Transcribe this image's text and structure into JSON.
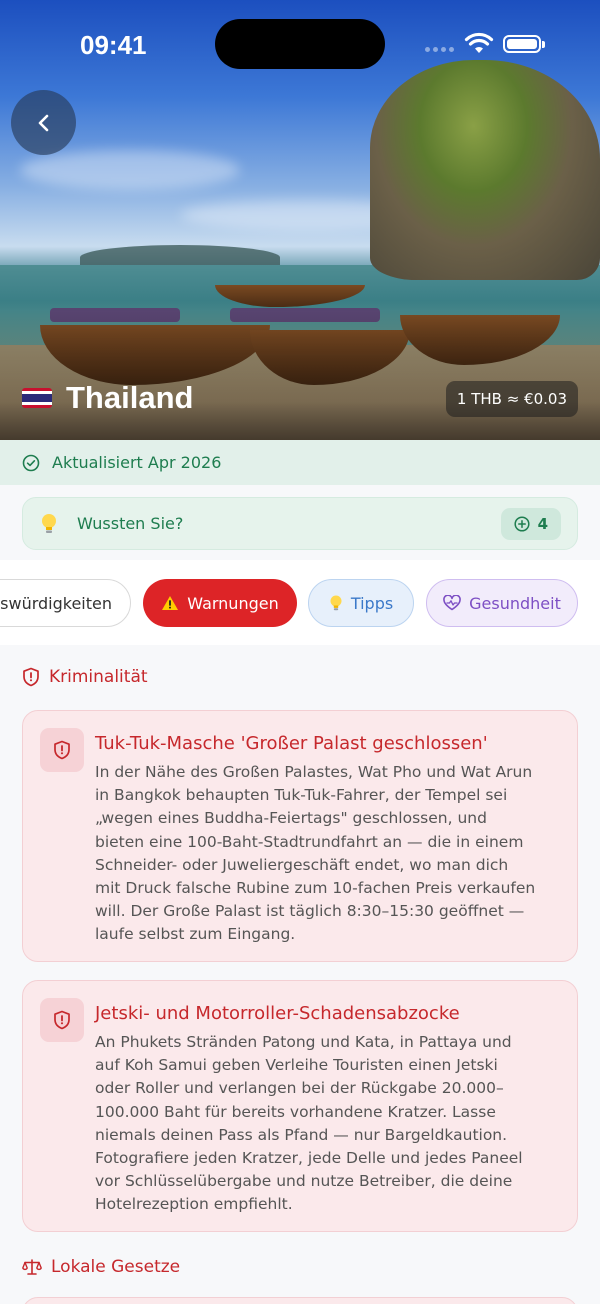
{
  "status_bar": {
    "time": "09:41"
  },
  "hero": {
    "back_icon": "chevron-left-icon",
    "country": "Thailand",
    "flag": "thailand-flag",
    "currency": "1 THB ≈ €0.03"
  },
  "updated": {
    "label": "Aktualisiert Apr 2026",
    "icon": "check-circle-icon"
  },
  "did_you_know": {
    "label": "Wussten Sie?",
    "count": "4",
    "icon": "lightbulb-icon"
  },
  "tabs": [
    {
      "label": "Sehenswürdigkeiten",
      "visible_label": "swürdigkeiten",
      "active": false
    },
    {
      "label": "Warnungen",
      "active": true,
      "icon": "warning-icon"
    },
    {
      "label": "Tipps",
      "active": false,
      "icon": "lightbulb-icon"
    },
    {
      "label": "Gesundheit",
      "active": false,
      "icon": "heart-pulse-icon"
    }
  ],
  "sections": {
    "crime": {
      "title": "Kriminalität",
      "icon": "shield-alert-icon",
      "cards": [
        {
          "title": "Tuk-Tuk-Masche 'Großer Palast geschlossen'",
          "body_lines": [
            "In der Nähe des Großen Palastes, Wat Pho und Wat Arun",
            "in Bangkok behaupten Tuk-Tuk-Fahrer, der Tempel sei",
            "„wegen eines Buddha-Feiertags\" geschlossen, und",
            "bieten eine 100-Baht-Stadtrundfahrt an — die in einem",
            "Schneider- oder Juweliergeschäft endet, wo man dich",
            "mit Druck falsche Rubine zum 10-fachen Preis verkaufen",
            "will. Der Große Palast ist täglich 8:30–15:30 geöffnet —",
            "laufe selbst zum Eingang."
          ]
        },
        {
          "title": "Jetski- und Motorroller-Schadensabzocke",
          "body_lines": [
            "An Phukets Stränden Patong und Kata, in Pattaya und",
            "auf Koh Samui geben Verleihe Touristen einen Jetski",
            "oder Roller und verlangen bei der Rückgabe 20.000–",
            "100.000 Baht für bereits vorhandene Kratzer. Lasse",
            "niemals deinen Pass als Pfand — nur Bargeldkaution.",
            "Fotografiere jeden Kratzer, jede Delle und jedes Paneel",
            "vor Schlüsselübergabe und nutze Betreiber, die deine",
            "Hotelrezeption empfiehlt."
          ]
        }
      ]
    },
    "laws": {
      "title": "Lokale Gesetze",
      "icon": "scales-icon"
    }
  },
  "colors": {
    "accent_red": "#dd2427",
    "success_green": "#1e7d4f",
    "tips_blue": "#3b79c9",
    "health_purple": "#7d4fc4"
  }
}
